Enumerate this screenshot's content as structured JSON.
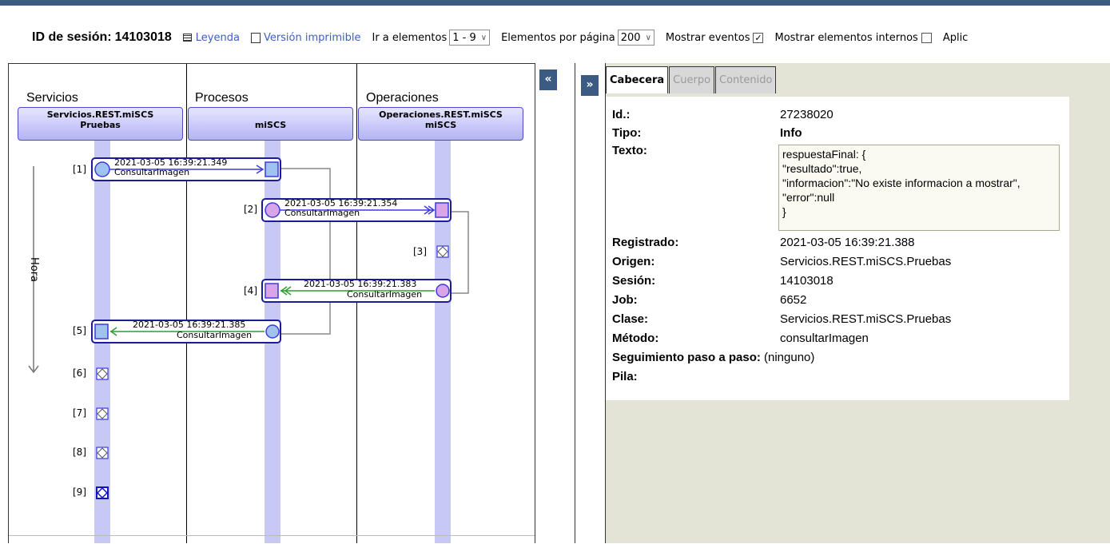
{
  "toolbar": {
    "session_label": "ID de sesión:",
    "session_id": "14103018",
    "legend_link": "Leyenda",
    "printable_link": "Versión imprimible",
    "goto_label": "Ir a elementos",
    "goto_value": "1 - 9",
    "per_page_label": "Elementos por página",
    "per_page_value": "200",
    "show_events_label": "Mostrar eventos",
    "show_events_checked": true,
    "show_internal_label": "Mostrar elementos internos",
    "show_internal_checked": false,
    "apply_label": "Aplic"
  },
  "diagram": {
    "columns": [
      {
        "title": "Servicios",
        "header_line1": "Servicios.REST.miSCS",
        "header_line2": "Pruebas"
      },
      {
        "title": "Procesos",
        "header_line1": "",
        "header_line2": "miSCS"
      },
      {
        "title": "Operaciones",
        "header_line1": "Operaciones.REST.miSCS",
        "header_line2": "miSCS"
      }
    ],
    "time_axis_label": "Hora",
    "messages": [
      {
        "index": "[1]",
        "time": "2021-03-05 16:39:21.349",
        "name": "ConsultarImagen"
      },
      {
        "index": "[2]",
        "time": "2021-03-05 16:39:21.354",
        "name": "ConsultarImagen"
      },
      {
        "index": "[4]",
        "time": "2021-03-05 16:39:21.383",
        "name": "ConsultarImagen"
      },
      {
        "index": "[5]",
        "time": "2021-03-05 16:39:21.385",
        "name": "ConsultarImagen"
      }
    ],
    "events": [
      "[3]",
      "[6]",
      "[7]",
      "[8]",
      "[9]"
    ],
    "collapse_left": "«",
    "expand_right": "»"
  },
  "details": {
    "tabs": [
      "Cabecera",
      "Cuerpo",
      "Contenido"
    ],
    "rows": {
      "id_label": "Id.:",
      "id_value": "27238020",
      "tipo_label": "Tipo:",
      "tipo_value": "Info",
      "texto_label": "Texto:",
      "texto_lines": [
        "respuestaFinal: {",
        "\"resultado\":true,",
        "\"informacion\":\"No existe informacion a mostrar\",",
        "\"error\":null",
        "}"
      ],
      "registrado_label": "Registrado:",
      "registrado_value": "2021-03-05 16:39:21.388",
      "origen_label": "Origen:",
      "origen_value": "Servicios.REST.miSCS.Pruebas",
      "sesion_label": "Sesión:",
      "sesion_value": "14103018",
      "job_label": "Job:",
      "job_value": "6652",
      "clase_label": "Clase:",
      "clase_value": "Servicios.REST.miSCS.Pruebas",
      "metodo_label": "Método:",
      "metodo_value": "consultarImagen",
      "seguimiento_label": "Seguimiento paso a paso:",
      "seguimiento_value": "(ninguno)",
      "pila_label": "Pila:"
    }
  },
  "colors": {
    "top_band": "#3b5b83",
    "lifeline": "#c8c8f5",
    "request_arrow": "#3a3ae0",
    "response_arrow": "#2f9e2f",
    "message_border": "#1c1c9a",
    "link": "#3d5ec8"
  }
}
